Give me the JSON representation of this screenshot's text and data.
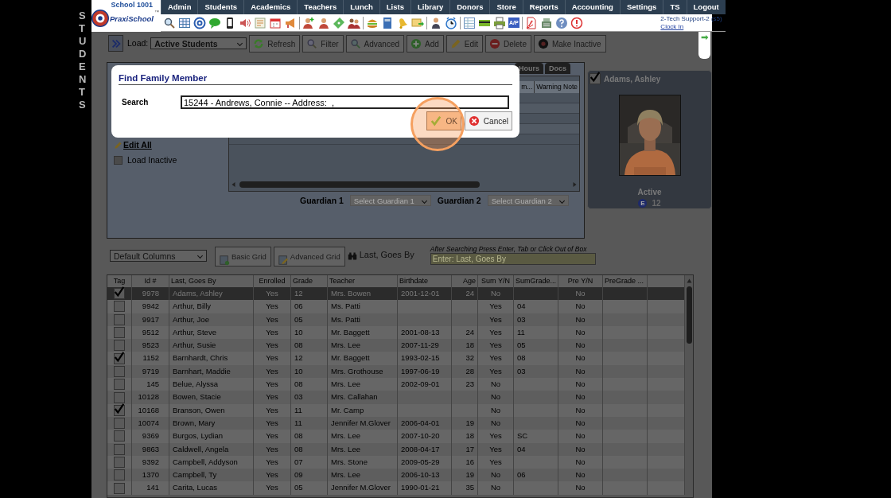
{
  "side_title": "STUDENTS",
  "logo": {
    "school": "School 1001",
    "brand": "PraxiSchool",
    "tm": "™"
  },
  "nav": [
    "Admin",
    "Students",
    "Academics",
    "Teachers",
    "Lunch",
    "Lists",
    "Library",
    "Donors",
    "Store",
    "Reports",
    "Accounting",
    "Settings",
    "TS",
    "Logout"
  ],
  "quick_badge": "A/P",
  "user": {
    "name": "2-Tech Support-2 (s5)",
    "clock_link": "Clock In"
  },
  "toolbar": {
    "load_label": "Load:",
    "load_value": "Active Students",
    "buttons": [
      {
        "label": "Refresh",
        "kind": "refresh"
      },
      {
        "label": "Filter",
        "kind": "filter"
      },
      {
        "label": "Advanced",
        "kind": "advanced"
      },
      {
        "label": "Add",
        "kind": "add"
      },
      {
        "label": "Edit",
        "kind": "edit"
      },
      {
        "label": "Delete",
        "kind": "delete"
      },
      {
        "label": "Make Inactive",
        "kind": "inactive"
      }
    ]
  },
  "panel": {
    "tabs": [
      "Hours",
      "Docs"
    ],
    "edit_all": "Edit All",
    "load_inactive": {
      "label": "Load Inactive",
      "checked": false
    },
    "inner_columns": [
      "m...",
      "Warning Note"
    ],
    "guardians": [
      {
        "label": "Guardian 1",
        "placeholder": "Select Guardian 1"
      },
      {
        "label": "Guardian 2",
        "placeholder": "Select Guardian 2"
      }
    ]
  },
  "card": {
    "name": "Adams, Ashley",
    "checked": true,
    "status": "Active",
    "badge": "E",
    "grade": "12"
  },
  "dialog": {
    "title": "Find Family Member",
    "search_label": "Search",
    "search_value": "15244 - Andrews, Connie -- Address:  ,",
    "buttons": [
      {
        "label": "OK",
        "kind": "ok",
        "highlighted": true
      },
      {
        "label": "Cancel",
        "kind": "cancel",
        "highlighted": false
      }
    ]
  },
  "grid_bar": {
    "columns_select": "Default Columns",
    "buttons": [
      {
        "label": "Basic Grid",
        "kind": "basic"
      },
      {
        "label": "Advanced Grid",
        "kind": "advanced"
      }
    ],
    "search_label": "Last, Goes By",
    "hint": "After Searching Press Enter, Tab or Click Out of Box",
    "placeholder": "Enter: Last, Goes By"
  },
  "table": {
    "tag_column": "Tag",
    "columns": [
      "Id #",
      "Last, Goes By",
      "Enrolled",
      "Grade",
      "Teacher",
      "Birthdate",
      "Age",
      "Sum Y/N",
      "SumGrade...",
      "Pre Y/N",
      "PreGrade ..."
    ],
    "rows": [
      {
        "tagged": true,
        "selected": true,
        "cells": [
          "9978",
          "Adams, Ashley",
          "Yes",
          "12",
          "Mrs. Bowen",
          "2001-12-01",
          "24",
          "No",
          null,
          "No",
          null
        ]
      },
      {
        "tagged": false,
        "selected": false,
        "cells": [
          "9942",
          "Arthur, Billy",
          "Yes",
          "06",
          "Ms. Patti",
          null,
          null,
          "Yes",
          "04",
          "No",
          null
        ]
      },
      {
        "tagged": false,
        "selected": false,
        "cells": [
          "9917",
          "Arthur, Joe",
          "Yes",
          "05",
          "Ms. Patti",
          null,
          null,
          "Yes",
          "03",
          "No",
          null
        ]
      },
      {
        "tagged": false,
        "selected": false,
        "cells": [
          "9512",
          "Arthur, Steve",
          "Yes",
          "10",
          "Mr. Baggett",
          "2001-08-13",
          "24",
          "Yes",
          "11",
          "No",
          null
        ]
      },
      {
        "tagged": false,
        "selected": false,
        "cells": [
          "9523",
          "Arthur, Susie",
          "Yes",
          "08",
          "Mrs. Lee",
          "2007-11-29",
          "18",
          "Yes",
          "05",
          "No",
          null
        ]
      },
      {
        "tagged": true,
        "selected": false,
        "cells": [
          "1152",
          "Barnhardt, Chris",
          "Yes",
          "12",
          "Mr. Baggett",
          "1993-02-15",
          "32",
          "Yes",
          "08",
          "No",
          null
        ]
      },
      {
        "tagged": false,
        "selected": false,
        "cells": [
          "9719",
          "Barnhart, Maddie",
          "Yes",
          "10",
          "Mrs. Grothouse",
          "1997-06-19",
          "28",
          "Yes",
          "03",
          "No",
          null
        ]
      },
      {
        "tagged": false,
        "selected": false,
        "cells": [
          "145",
          "Belue, Alyssa",
          "Yes",
          "08",
          "Mrs. Lee",
          "2002-09-01",
          "23",
          "No",
          null,
          "No",
          null
        ]
      },
      {
        "tagged": false,
        "selected": false,
        "cells": [
          "10128",
          "Bowen, Stacie",
          "Yes",
          "03",
          "Mrs. Callahan",
          null,
          null,
          "No",
          null,
          "No",
          null
        ]
      },
      {
        "tagged": true,
        "selected": false,
        "cells": [
          "10168",
          "Branson, Owen",
          "Yes",
          "11",
          "Mr. Camp",
          null,
          null,
          "No",
          null,
          "No",
          null
        ]
      },
      {
        "tagged": false,
        "selected": false,
        "cells": [
          "10074",
          "Brown, Mary",
          "Yes",
          "11",
          "Jennifer M.Glover",
          "2006-04-01",
          "19",
          "No",
          null,
          "No",
          null
        ]
      },
      {
        "tagged": false,
        "selected": false,
        "cells": [
          "9369",
          "Burgos, Lydian",
          "Yes",
          "08",
          "Mrs. Lee",
          "2007-10-20",
          "18",
          "Yes",
          "SC",
          "No",
          null
        ]
      },
      {
        "tagged": false,
        "selected": false,
        "cells": [
          "9863",
          "Caldwell, Angela",
          "Yes",
          "08",
          "Mrs. Lee",
          "2008-04-17",
          "17",
          "Yes",
          "04",
          "No",
          null
        ]
      },
      {
        "tagged": false,
        "selected": false,
        "cells": [
          "9392",
          "Campbell, Addyson",
          "Yes",
          "07",
          "Mrs. Stone",
          "2009-05-29",
          "16",
          "Yes",
          null,
          "No",
          null
        ]
      },
      {
        "tagged": false,
        "selected": false,
        "cells": [
          "1370",
          "Campbell, Ty",
          "Yes",
          "09",
          "Mrs. Lee",
          "2006-10-13",
          "19",
          "No",
          "06",
          "No",
          null
        ]
      },
      {
        "tagged": false,
        "selected": false,
        "cells": [
          "141",
          "Carita, Lucas",
          "Yes",
          "05",
          "Jennifer M.Glover",
          "1990-01-21",
          "35",
          "No",
          null,
          "No",
          null
        ]
      }
    ]
  }
}
